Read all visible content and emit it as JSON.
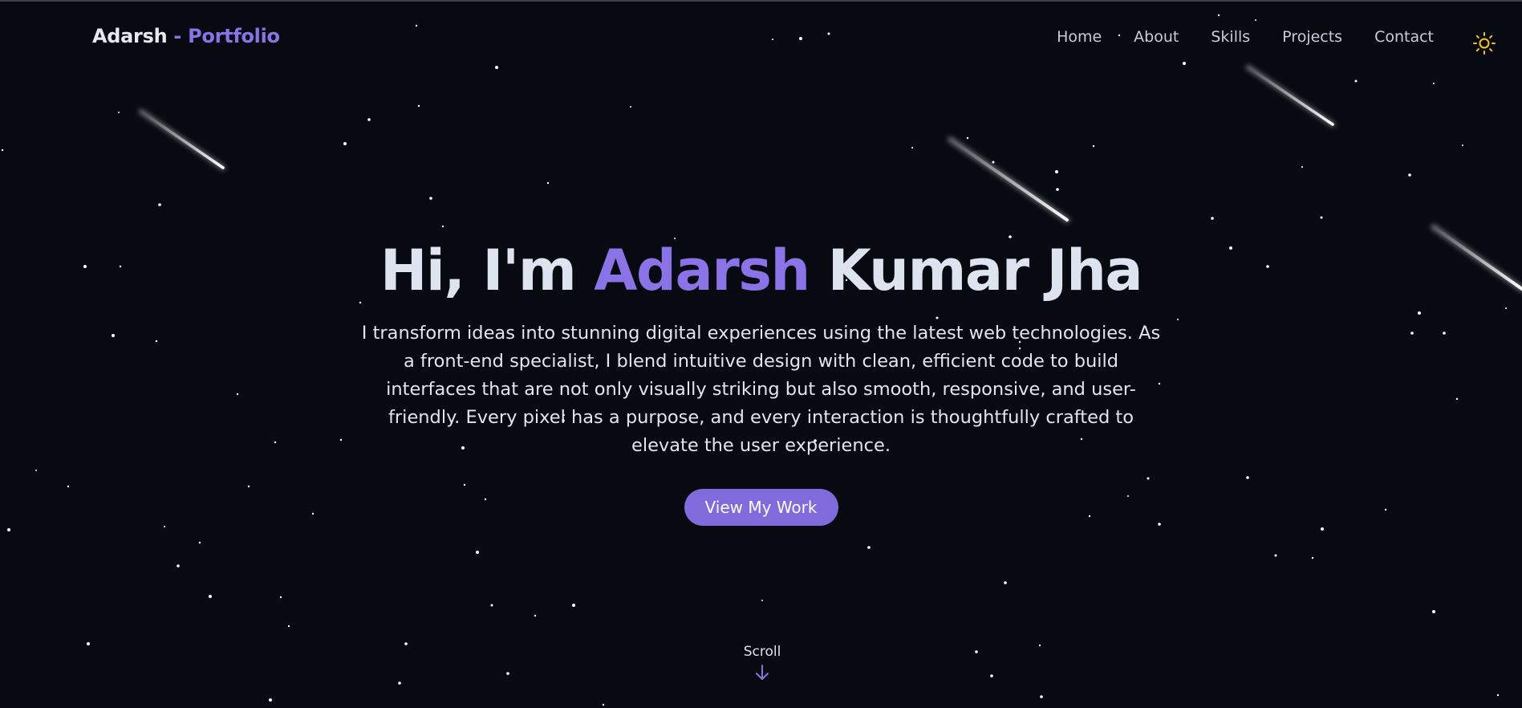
{
  "brand": {
    "name": "Adarsh",
    "suffix": "- Portfolio"
  },
  "nav": {
    "items": [
      {
        "label": "Home"
      },
      {
        "label": "About"
      },
      {
        "label": "Skills"
      },
      {
        "label": "Projects"
      },
      {
        "label": "Contact"
      }
    ],
    "theme_toggle_icon": "sun-icon"
  },
  "hero": {
    "greeting": "Hi, I'm",
    "first_name": "Adarsh",
    "last_name": "Kumar Jha",
    "description": "I transform ideas into stunning digital experiences using the latest web technologies. As a front-end specialist, I blend intuitive design with clean, efficient code to build interfaces that are not only visually striking but also smooth, responsive, and user-friendly. Every pixel has a purpose, and every interaction is thoughtfully crafted to elevate the user experience.",
    "cta_label": "View My Work"
  },
  "scroll": {
    "label": "Scroll",
    "icon": "arrow-down-icon"
  },
  "colors": {
    "background": "#080a12",
    "accent": "#8a73e6",
    "button": "#7f6bdc",
    "text": "#e6e8f2",
    "sun": "#f5c518"
  }
}
